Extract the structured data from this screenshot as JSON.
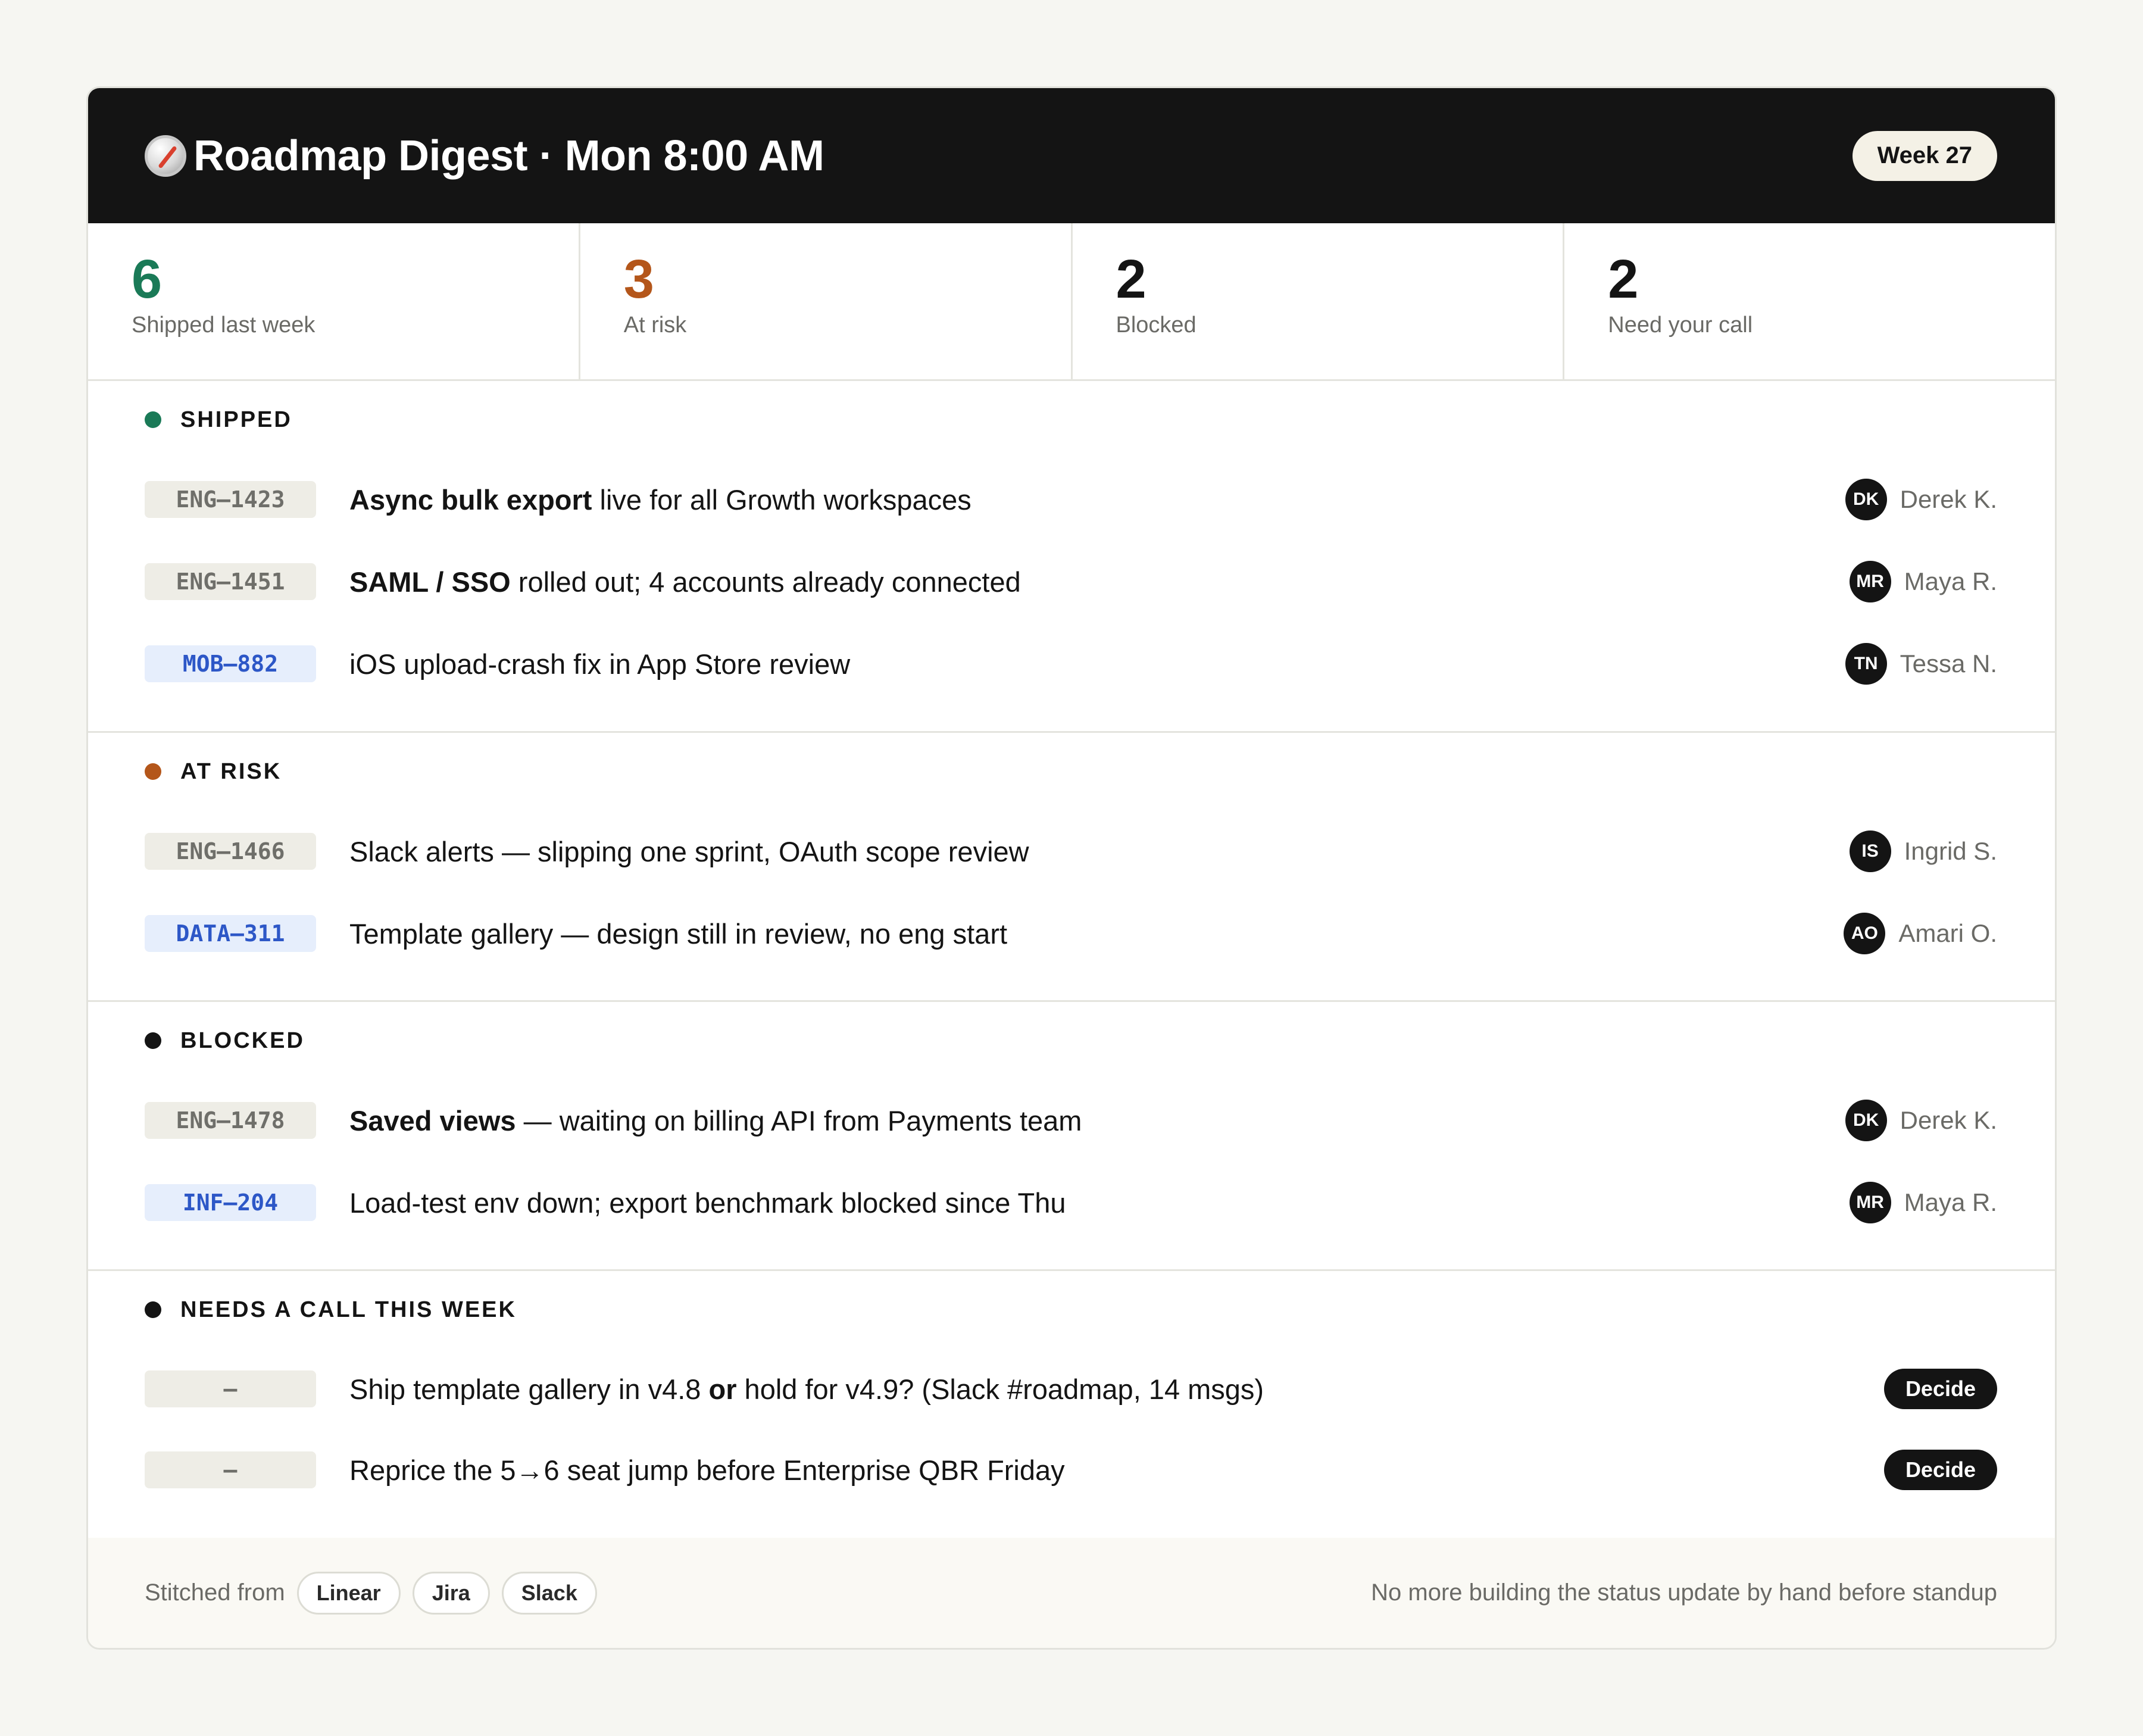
{
  "header": {
    "title": "Roadmap Digest · Mon 8:00 AM",
    "week": "Week 27",
    "icon": "compass-icon"
  },
  "stats": [
    {
      "value": "6",
      "label": "Shipped last week",
      "color": "#1a7a57"
    },
    {
      "value": "3",
      "label": "At risk",
      "color": "#b4561a"
    },
    {
      "value": "2",
      "label": "Blocked",
      "color": "#141414"
    },
    {
      "value": "2",
      "label": "Need your call",
      "color": "#141414"
    }
  ],
  "sections": {
    "shipped": {
      "title": "SHIPPED",
      "color": "#1a7a57",
      "rows": [
        {
          "tag": "ENG–1423",
          "bold": "Async bulk export",
          "text": " live for all Growth workspaces",
          "initials": "DK",
          "owner": "Derek K."
        },
        {
          "tag": "ENG–1451",
          "bold": "SAML / SSO",
          "text": " rolled out; 4 accounts already connected",
          "initials": "MR",
          "owner": "Maya R."
        },
        {
          "tag": "MOB–882",
          "bold": "",
          "text": "iOS upload-crash fix in App Store review",
          "initials": "TN",
          "owner": "Tessa N."
        }
      ]
    },
    "at_risk": {
      "title": "AT RISK",
      "color": "#b4561a",
      "rows": [
        {
          "tag": "ENG–1466",
          "bold": "",
          "text": "Slack alerts — slipping one sprint, OAuth scope review",
          "initials": "IS",
          "owner": "Ingrid S."
        },
        {
          "tag": "DATA–311",
          "bold": "",
          "text": "Template gallery — design still in review, no eng start",
          "initials": "AO",
          "owner": "Amari O."
        }
      ]
    },
    "blocked": {
      "title": "BLOCKED",
      "color": "#141414",
      "rows": [
        {
          "tag": "ENG–1478",
          "bold": "Saved views",
          "text": " — waiting on billing API from Payments team",
          "initials": "DK",
          "owner": "Derek K."
        },
        {
          "tag": "INF–204",
          "bold": "",
          "text": "Load-test env down; export benchmark blocked since Thu",
          "initials": "MR",
          "owner": "Maya R."
        }
      ]
    },
    "needs_call": {
      "title": "NEEDS A CALL THIS WEEK",
      "color": "#141414",
      "rows": [
        {
          "tag": "–",
          "pre": "Ship template gallery in v4.8 ",
          "bold": "or",
          "text": " hold for v4.9? (Slack #roadmap, 14 msgs)",
          "action": "Decide"
        },
        {
          "tag": "–",
          "pre": "",
          "bold": "",
          "text": "Reprice the 5→6 seat jump before Enterprise QBR Friday",
          "action": "Decide"
        }
      ]
    }
  },
  "footer": {
    "stitched_label": "Stitched from",
    "sources": [
      "Linear",
      "Jira",
      "Slack"
    ],
    "tagline": "No more building the status update by hand before standup"
  }
}
